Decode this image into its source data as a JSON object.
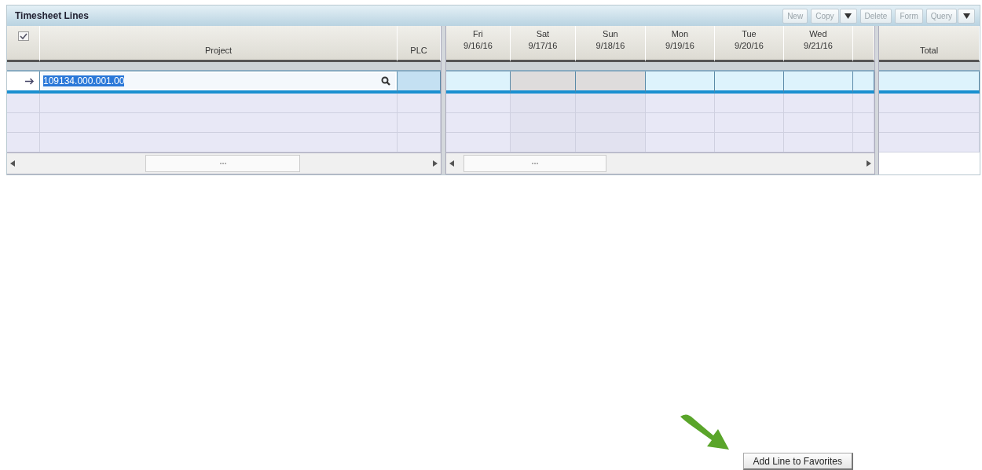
{
  "panel": {
    "title": "Timesheet Lines"
  },
  "toolbar": [
    {
      "kind": "button",
      "label": "New",
      "disabled": true
    },
    {
      "kind": "button",
      "label": "Copy",
      "disabled": true
    },
    {
      "kind": "dropdown",
      "disabled": false
    },
    {
      "kind": "button",
      "label": "Delete",
      "disabled": true
    },
    {
      "kind": "button",
      "label": "Form",
      "disabled": true
    },
    {
      "kind": "button",
      "label": "Query",
      "disabled": true
    },
    {
      "kind": "dropdown",
      "disabled": false
    }
  ],
  "columns": {
    "select_all": {
      "checked": true
    },
    "project": "Project",
    "plc": "PLC",
    "days": [
      {
        "day": "Fri",
        "date": "9/16/16",
        "weekend": false
      },
      {
        "day": "Sat",
        "date": "9/17/16",
        "weekend": true
      },
      {
        "day": "Sun",
        "date": "9/18/16",
        "weekend": true
      },
      {
        "day": "Mon",
        "date": "9/19/16",
        "weekend": false
      },
      {
        "day": "Tue",
        "date": "9/20/16",
        "weekend": false
      },
      {
        "day": "Wed",
        "date": "9/21/16",
        "weekend": false
      }
    ],
    "total": "Total"
  },
  "rows": [
    {
      "selected": true,
      "project": "109134.000.001.00"
    },
    {
      "selected": false
    },
    {
      "selected": false
    },
    {
      "selected": false
    }
  ],
  "add_favorite_button": "Add Line to Favorites"
}
